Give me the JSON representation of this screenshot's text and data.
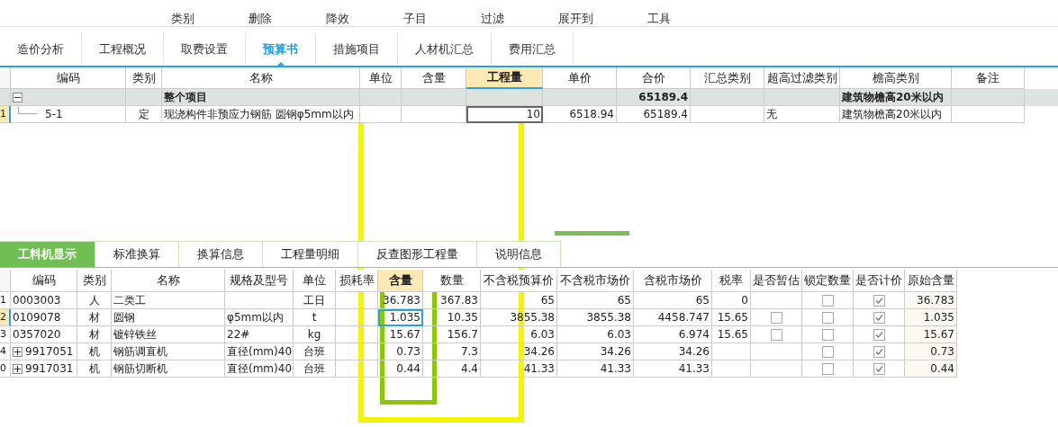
{
  "toolbar": {
    "items": [
      {
        "label": "类别"
      },
      {
        "label": "删除"
      },
      {
        "label": "降效"
      },
      {
        "label": "子目"
      },
      {
        "label": "过滤"
      },
      {
        "label": "展开到"
      },
      {
        "label": "工具"
      }
    ]
  },
  "tabs": [
    {
      "label": "造价分析",
      "selected": false
    },
    {
      "label": "工程概况",
      "selected": false
    },
    {
      "label": "取费设置",
      "selected": false
    },
    {
      "label": "预算书",
      "selected": true
    },
    {
      "label": "措施项目",
      "selected": false
    },
    {
      "label": "人材机汇总",
      "selected": false
    },
    {
      "label": "费用汇总",
      "selected": false
    }
  ],
  "budget_table": {
    "columns": [
      {
        "label": "编码",
        "selected": false
      },
      {
        "label": "类别",
        "selected": false
      },
      {
        "label": "名称",
        "selected": false
      },
      {
        "label": "单位",
        "selected": false
      },
      {
        "label": "含量",
        "selected": false
      },
      {
        "label": "工程量",
        "selected": true
      },
      {
        "label": "单价",
        "selected": false
      },
      {
        "label": "合价",
        "selected": false
      },
      {
        "label": "汇总类别",
        "selected": false
      },
      {
        "label": "超高过滤类别",
        "selected": false
      },
      {
        "label": "檐高类别",
        "selected": false
      },
      {
        "label": "备注",
        "selected": false
      }
    ],
    "rows": [
      {
        "kind": "group",
        "number": "",
        "selected": false,
        "expanded": true,
        "cells": [
          "",
          "",
          "整个项目",
          "",
          "",
          "",
          "",
          "65189.4",
          "",
          "",
          "建筑物檐高20米以内",
          ""
        ]
      },
      {
        "kind": "item",
        "number": "1",
        "selected": true,
        "cells": [
          "5-1",
          "定",
          "现浇构件非预应力钢筋 圆钢φ5mm以内",
          "",
          "",
          "10",
          "6518.94",
          "65189.4",
          "",
          "无",
          "建筑物檐高20米以内",
          ""
        ]
      }
    ]
  },
  "detail_tabs": [
    {
      "label": "工料机显示",
      "selected": true
    },
    {
      "label": "标准换算",
      "selected": false
    },
    {
      "label": "换算信息",
      "selected": false
    },
    {
      "label": "工程量明细",
      "selected": false
    },
    {
      "label": "反查图形工程量",
      "selected": false
    },
    {
      "label": "说明信息",
      "selected": false
    }
  ],
  "resource_table": {
    "columns": [
      {
        "label": "编码",
        "selected": false
      },
      {
        "label": "类别",
        "selected": false
      },
      {
        "label": "名称",
        "selected": false
      },
      {
        "label": "规格及型号",
        "selected": false
      },
      {
        "label": "单位",
        "selected": false
      },
      {
        "label": "损耗率",
        "selected": false
      },
      {
        "label": "含量",
        "selected": true
      },
      {
        "label": "数量",
        "selected": false
      },
      {
        "label": "不含税预算价",
        "selected": false
      },
      {
        "label": "不含税市场价",
        "selected": false
      },
      {
        "label": "含税市场价",
        "selected": false
      },
      {
        "label": "税率",
        "selected": false
      },
      {
        "label": "是否暂估",
        "selected": false
      },
      {
        "label": "锁定数量",
        "selected": false
      },
      {
        "label": "是否计价",
        "selected": false
      },
      {
        "label": "原始含量",
        "selected": false
      }
    ],
    "rows": [
      {
        "number": "1",
        "selected": false,
        "code": "0003003",
        "type": "人",
        "name": "二类工",
        "spec": "",
        "unit": "工日",
        "loss": "",
        "content": "36.783",
        "quantity": "367.83",
        "budget_price": "65",
        "market_price": "65",
        "tax_market_price": "65",
        "tax_rate": "0",
        "locked": false,
        "priced": true,
        "original_content": "36.783"
      },
      {
        "number": "2",
        "selected": true,
        "code": "0109078",
        "type": "材",
        "name": "圆钢",
        "spec": "φ5mm以内",
        "unit": "t",
        "loss": "",
        "content": "1.035",
        "quantity": "10.35",
        "budget_price": "3855.38",
        "market_price": "3855.38",
        "tax_market_price": "4458.747",
        "tax_rate": "15.65",
        "estimated": false,
        "locked": false,
        "priced": true,
        "original_content": "1.035"
      },
      {
        "number": "3",
        "selected": false,
        "code": "0357020",
        "type": "材",
        "name": "镀锌铁丝",
        "spec": "22#",
        "unit": "kg",
        "loss": "",
        "content": "15.67",
        "quantity": "156.7",
        "budget_price": "6.03",
        "market_price": "6.03",
        "tax_market_price": "6.974",
        "tax_rate": "15.65",
        "estimated": false,
        "locked": false,
        "priced": true,
        "original_content": "15.67"
      },
      {
        "number": "4",
        "selected": false,
        "expanded": false,
        "code": "9917051",
        "type": "机",
        "name": "钢筋调直机",
        "spec": "直径(mm)40",
        "unit": "台班",
        "loss": "",
        "content": "0.73",
        "quantity": "7.3",
        "budget_price": "34.26",
        "market_price": "34.26",
        "tax_market_price": "34.26",
        "tax_rate": "",
        "locked": false,
        "priced": true,
        "original_content": "0.73"
      },
      {
        "number": "0",
        "selected": false,
        "expanded": false,
        "code": "9917031",
        "type": "机",
        "name": "钢筋切断机",
        "spec": "直径(mm)40",
        "unit": "台班",
        "loss": "",
        "content": "0.44",
        "quantity": "4.4",
        "budget_price": "41.33",
        "market_price": "41.33",
        "tax_market_price": "41.33",
        "tax_rate": "",
        "locked": false,
        "priced": true,
        "original_content": "0.44"
      }
    ]
  }
}
